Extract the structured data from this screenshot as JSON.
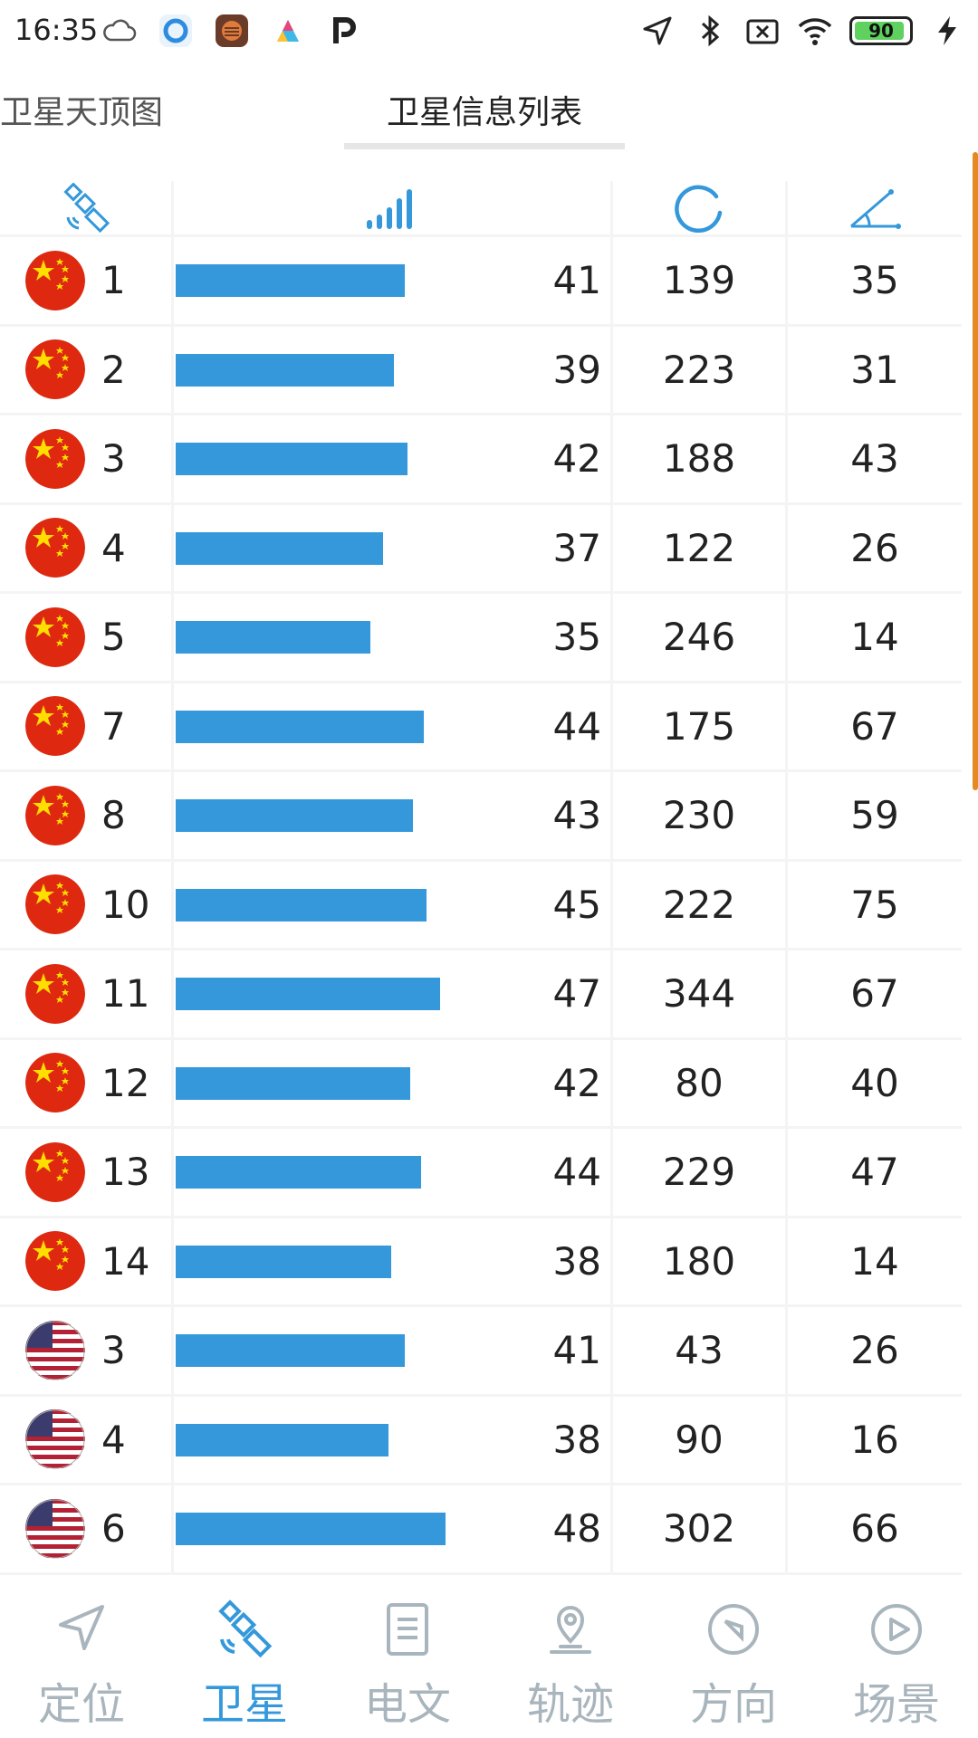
{
  "status": {
    "time": "16:35",
    "battery": "90"
  },
  "tabs": {
    "sky": "卫星天顶图",
    "list": "卫星信息列表"
  },
  "table": {
    "rows": [
      {
        "flag": "china",
        "prn": "1",
        "cn0": "41",
        "azimuth": "139",
        "elevation": "35",
        "signal_ratio": 0.85
      },
      {
        "flag": "china",
        "prn": "2",
        "cn0": "39",
        "azimuth": "223",
        "elevation": "31",
        "signal_ratio": 0.81
      },
      {
        "flag": "china",
        "prn": "3",
        "cn0": "42",
        "azimuth": "188",
        "elevation": "43",
        "signal_ratio": 0.86
      },
      {
        "flag": "china",
        "prn": "4",
        "cn0": "37",
        "azimuth": "122",
        "elevation": "26",
        "signal_ratio": 0.77
      },
      {
        "flag": "china",
        "prn": "5",
        "cn0": "35",
        "azimuth": "246",
        "elevation": "14",
        "signal_ratio": 0.72
      },
      {
        "flag": "china",
        "prn": "7",
        "cn0": "44",
        "azimuth": "175",
        "elevation": "67",
        "signal_ratio": 0.92
      },
      {
        "flag": "china",
        "prn": "8",
        "cn0": "43",
        "azimuth": "230",
        "elevation": "59",
        "signal_ratio": 0.88
      },
      {
        "flag": "china",
        "prn": "10",
        "cn0": "45",
        "azimuth": "222",
        "elevation": "75",
        "signal_ratio": 0.93
      },
      {
        "flag": "china",
        "prn": "11",
        "cn0": "47",
        "azimuth": "344",
        "elevation": "67",
        "signal_ratio": 0.98
      },
      {
        "flag": "china",
        "prn": "12",
        "cn0": "42",
        "azimuth": "80",
        "elevation": "40",
        "signal_ratio": 0.87
      },
      {
        "flag": "china",
        "prn": "13",
        "cn0": "44",
        "azimuth": "229",
        "elevation": "47",
        "signal_ratio": 0.91
      },
      {
        "flag": "china",
        "prn": "14",
        "cn0": "38",
        "azimuth": "180",
        "elevation": "14",
        "signal_ratio": 0.8
      },
      {
        "flag": "usa",
        "prn": "3",
        "cn0": "41",
        "azimuth": "43",
        "elevation": "26",
        "signal_ratio": 0.85
      },
      {
        "flag": "usa",
        "prn": "4",
        "cn0": "38",
        "azimuth": "90",
        "elevation": "16",
        "signal_ratio": 0.79
      },
      {
        "flag": "usa",
        "prn": "6",
        "cn0": "48",
        "azimuth": "302",
        "elevation": "66",
        "signal_ratio": 1.0
      }
    ]
  },
  "nav": {
    "items": [
      {
        "label": "定位",
        "icon": "navigation-arrow-icon"
      },
      {
        "label": "卫星",
        "icon": "satellite-icon"
      },
      {
        "label": "电文",
        "icon": "document-icon"
      },
      {
        "label": "轨迹",
        "icon": "location-pin-icon"
      },
      {
        "label": "方向",
        "icon": "compass-icon"
      },
      {
        "label": "场景",
        "icon": "play-circle-icon"
      }
    ],
    "active_index": 1
  },
  "colors": {
    "accent": "#3498db",
    "inactive": "#a9b5bd",
    "scrollbar": "#e38a23"
  }
}
